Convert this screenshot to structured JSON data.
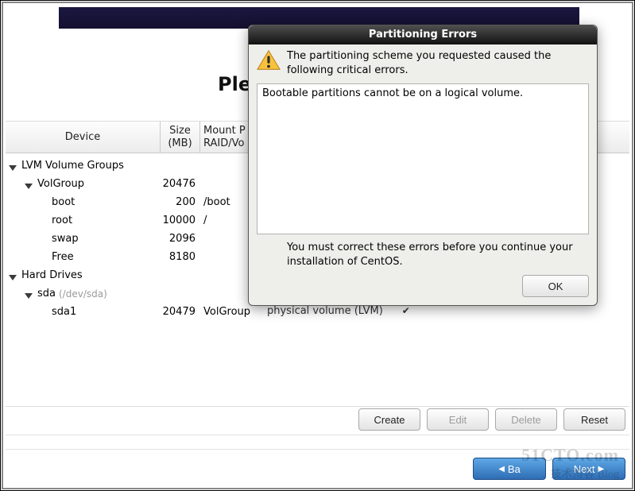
{
  "heading_partial": "Ple",
  "table": {
    "headers": {
      "device": "Device",
      "size_l1": "Size",
      "size_l2": "(MB)",
      "mount_l1": "Mount P",
      "mount_l2": "RAID/Vo"
    },
    "rows": {
      "lvm_group_label": "LVM Volume Groups",
      "volgroup": {
        "name": "VolGroup",
        "size": "20476"
      },
      "boot": {
        "name": "boot",
        "size": "200",
        "mount": "/boot"
      },
      "root": {
        "name": "root",
        "size": "10000",
        "mount": "/"
      },
      "swap": {
        "name": "swap",
        "size": "2096"
      },
      "free": {
        "name": "Free",
        "size": "8180"
      },
      "hard_drives_label": "Hard Drives",
      "sda": {
        "name": "sda",
        "path": "(/dev/sda)"
      },
      "sda1": {
        "name": "sda1",
        "size": "20479",
        "mount": "VolGroup"
      }
    }
  },
  "pv_partial": "physical volume (LVM)",
  "buttons": {
    "create": "Create",
    "edit": "Edit",
    "delete": "Delete",
    "reset": "Reset",
    "back": "Ba",
    "next": "Next"
  },
  "dialog": {
    "title": "Partitioning Errors",
    "message": "The partitioning scheme you requested caused the following critical errors.",
    "error": "Bootable partitions cannot be on a logical volume.",
    "note": "You must correct these errors before you continue your installation of CentOS.",
    "ok": "OK"
  },
  "watermark": {
    "line1": "51CTO.com",
    "line2": "技术博客 Blog"
  }
}
